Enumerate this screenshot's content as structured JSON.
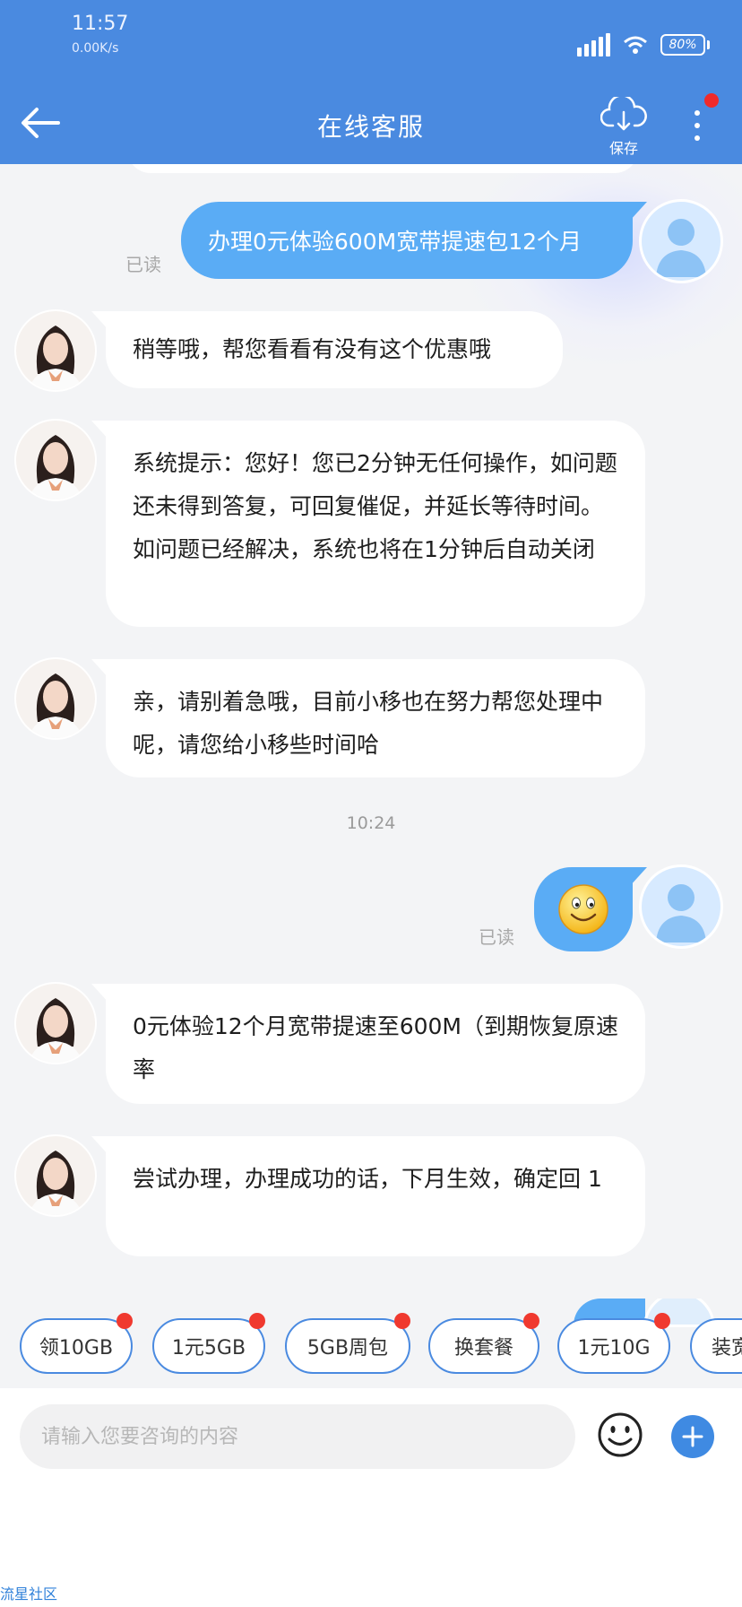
{
  "status_bar": {
    "time": "11:57",
    "net_speed": "0.00K/s",
    "battery": "80%",
    "icons": [
      "signal-icon",
      "wifi-icon",
      "battery-icon"
    ]
  },
  "header": {
    "title": "在线客服",
    "save_label": "保存",
    "icons": [
      "back-arrow-icon",
      "cloud-download-icon",
      "more-vertical-icon"
    ]
  },
  "chat": {
    "timestamp": "10:24",
    "messages": [
      {
        "from": "user",
        "text": "办理0元体验600M宽带提速包12个月",
        "status": "已读"
      },
      {
        "from": "agent",
        "text": "稍等哦，帮您看看有没有这个优惠哦"
      },
      {
        "from": "agent",
        "text": "系统提示：您好！您已2分钟无任何操作，如问题还未得到答复，可回复催促，并延长等待时间。如问题已经解决，系统也将在1分钟后自动关闭"
      },
      {
        "from": "agent",
        "text": "亲，请别着急哦，目前小移也在努力帮您处理中呢，请您给小移些时间哈"
      },
      {
        "from": "user",
        "emoji": "smiley-emoji",
        "status": "已读"
      },
      {
        "from": "agent",
        "text": "0元体验12个月宽带提速至600M（到期恢复原速率"
      },
      {
        "from": "agent",
        "text": "尝试办理，办理成功的话，下月生效，确定回 1"
      }
    ]
  },
  "quick_replies": [
    "领10GB",
    "1元5GB",
    "5GB周包",
    "换套餐",
    "1元10G",
    "装宽带"
  ],
  "input": {
    "placeholder": "请输入您要咨询的内容",
    "icons": [
      "emoji-icon",
      "plus-icon"
    ]
  },
  "watermark": "流星社区",
  "colors": {
    "primary": "#4a8ae0",
    "user_bubble": "#5aacf5",
    "badge": "#f0392f"
  }
}
